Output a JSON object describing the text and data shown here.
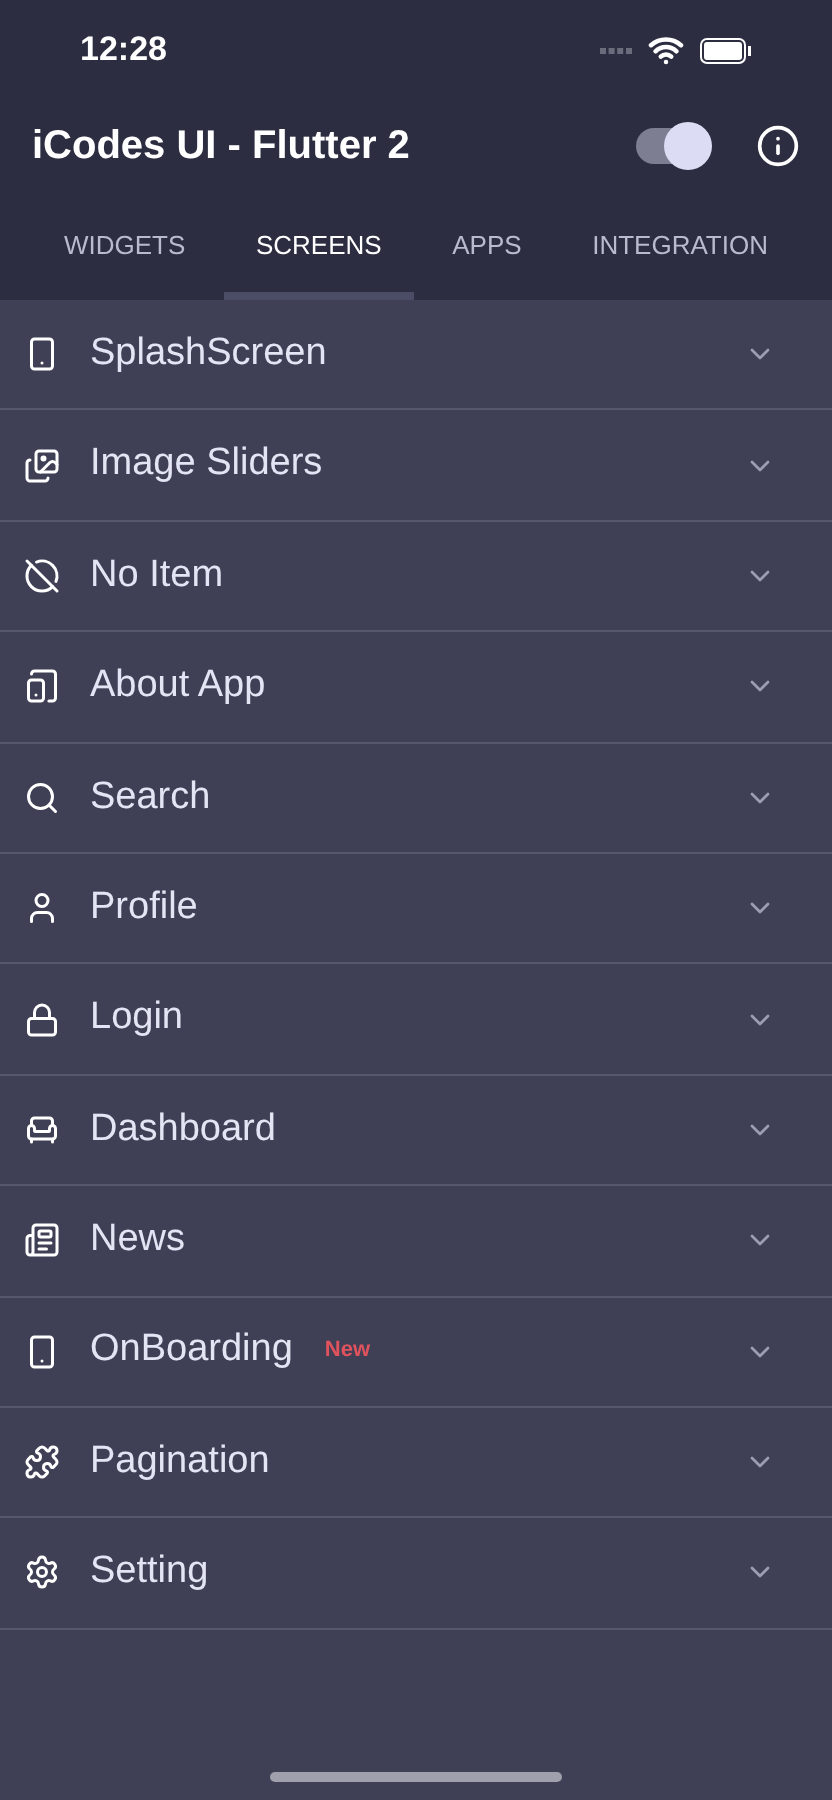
{
  "status_bar": {
    "time": "12:28"
  },
  "app_bar": {
    "title": "iCodes UI - Flutter 2",
    "theme_switch": {
      "on": true
    }
  },
  "tabs": [
    {
      "label": "WIDGETS",
      "selected": false
    },
    {
      "label": "SCREENS",
      "selected": true
    },
    {
      "label": "APPS",
      "selected": false
    },
    {
      "label": "INTEGRATION",
      "selected": false
    }
  ],
  "items": [
    {
      "label": "SplashScreen",
      "expanded": false
    },
    {
      "label": "Image Sliders",
      "expanded": false
    },
    {
      "label": "No Item",
      "expanded": false
    },
    {
      "label": "About App",
      "expanded": false
    },
    {
      "label": "Search",
      "expanded": false
    },
    {
      "label": "Profile",
      "expanded": false
    },
    {
      "label": "Login",
      "expanded": false
    },
    {
      "label": "Dashboard",
      "expanded": false
    },
    {
      "label": "News",
      "expanded": false
    },
    {
      "label": "OnBoarding",
      "badge": "New",
      "expanded": false
    },
    {
      "label": "Pagination",
      "expanded": false
    },
    {
      "label": "Setting",
      "expanded": false
    }
  ]
}
